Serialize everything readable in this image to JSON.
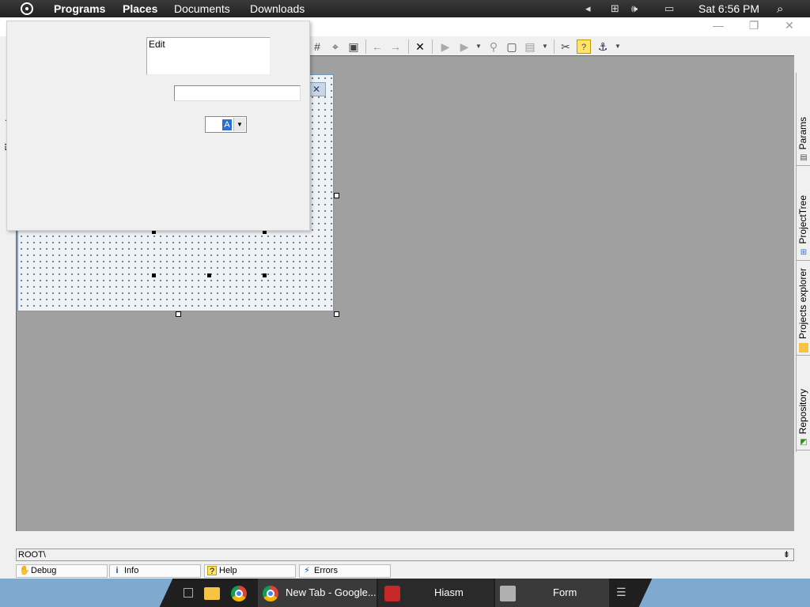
{
  "top_panel": {
    "menu": [
      "Programs",
      "Places",
      "Documents",
      "Downloads"
    ],
    "clock": "Sat 6:56 PM",
    "icons": [
      "activities-icon",
      "arrow-left-icon",
      "network-icon",
      "volume-icon",
      "display-icon",
      "search-icon"
    ]
  },
  "toolbar": {
    "icons": [
      "grid-icon",
      "align-center-icon",
      "fit-icon",
      "undo-icon",
      "redo-icon",
      "delete-icon",
      "run-icon",
      "run-dropdown-icon",
      "step-icon",
      "form-icon",
      "project-dropdown-icon",
      "tools-icon",
      "help-icon",
      "anchor-icon"
    ]
  },
  "popup": {
    "memo_text": "Edit",
    "edit_value": "",
    "combo_value": "A"
  },
  "left_strip": {
    "tab_label": "Elements"
  },
  "right_tabs": [
    {
      "label": "Params",
      "icon": "params-icon"
    },
    {
      "label": "ProjectTree",
      "icon": "project-tree-icon"
    },
    {
      "label": "Projects explorer",
      "icon": "folder-icon"
    },
    {
      "label": "Repository",
      "icon": "repository-icon"
    }
  ],
  "path_bar": {
    "text": "ROOT\\"
  },
  "bottom_tabs": [
    {
      "label": "Debug",
      "icon": "hand-icon"
    },
    {
      "label": "Info",
      "icon": "info-icon"
    },
    {
      "label": "Help",
      "icon": "help-icon"
    },
    {
      "label": "Errors",
      "icon": "errors-icon"
    }
  ],
  "taskbar": {
    "apps": [
      {
        "label": "New Tab - Google...",
        "icon": "chrome-icon"
      },
      {
        "label": "Hiasm",
        "icon": "hiasm-icon"
      },
      {
        "label": "Form",
        "icon": "form-icon"
      }
    ]
  },
  "colors": {
    "top_panel": "#202020",
    "canvas": "#a0a0a0",
    "taskbar": "#7fa9cf",
    "taskbar_dark": "#1f1f1f",
    "selection": "#2a6fd6"
  }
}
